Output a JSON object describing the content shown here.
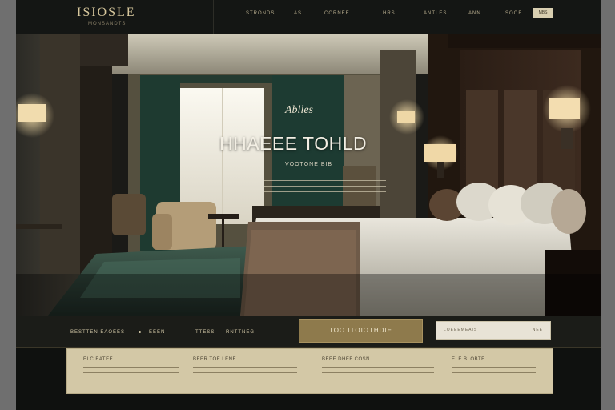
{
  "header": {
    "brand": "ISIOSLE",
    "tagline": "MONSANDTS",
    "nav": [
      "STRONDS",
      "AS",
      "CORNEE",
      "HRS",
      "ANTLES",
      "ANN",
      "SOOE"
    ],
    "cta": "MBS"
  },
  "hero": {
    "script": "Ablles",
    "title": "HHAEEE TOHLD",
    "subtitle": "VOOTONE BIB"
  },
  "booking": {
    "items": [
      "BESTTEN EAOEES",
      "EEEN",
      "TTESS",
      "RNTTNEG'"
    ],
    "book_button": "TOO ITOIOTHDIE",
    "search_placeholder": "LOEEEMEAIS",
    "search_go": "NEE"
  },
  "info": {
    "columns": [
      {
        "title": "ELC EATEE"
      },
      {
        "title": "BEER TOE LENE"
      },
      {
        "title": "BEEE DHEF COSN"
      },
      {
        "title": "ELE BLOBTE"
      }
    ]
  },
  "colors": {
    "accent_gold": "#8e7a4c",
    "panel_beige": "#d3c8a6",
    "header_dark": "#141614",
    "brand_text": "#d8c89d"
  }
}
